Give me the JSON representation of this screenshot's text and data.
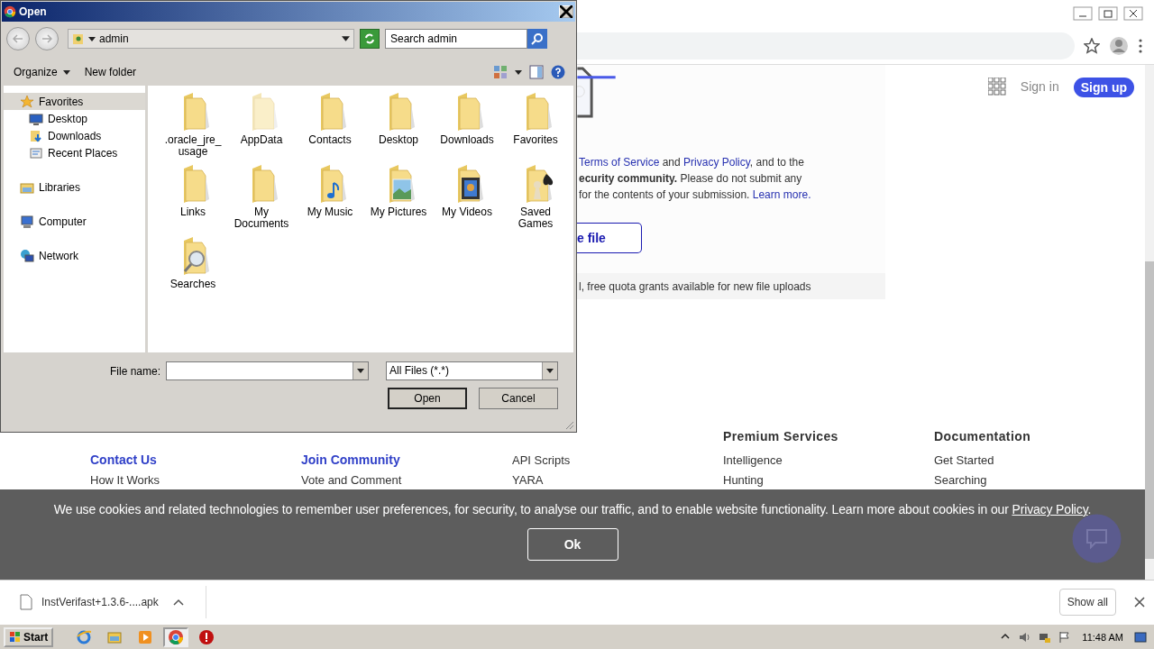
{
  "page": {
    "header": {
      "sign_in": "Sign in",
      "sign_up": "Sign up"
    },
    "upload": {
      "lines": [
        [
          {
            "kind": "link",
            "text": "Terms of Service"
          },
          {
            "kind": "text",
            "text": " and "
          },
          {
            "kind": "link",
            "text": "Privacy Policy"
          },
          {
            "kind": "text",
            "text": ", and to the"
          }
        ],
        [
          {
            "kind": "text",
            "text": "**ecurity community.** Please do not submit any"
          }
        ],
        [
          {
            "kind": "text",
            "text": "for the contents of your submission. "
          },
          {
            "kind": "link",
            "text": "Learn more."
          }
        ]
      ],
      "button": "e file",
      "quota": "l, free quota grants available for new file uploads"
    },
    "footer": {
      "columns": [
        {
          "links": [
            {
              "text": "Contact Us",
              "kind": "primary"
            },
            {
              "text": "How It Works",
              "kind": "plain"
            }
          ]
        },
        {
          "links": [
            {
              "text": "Join Community",
              "kind": "primary"
            },
            {
              "text": "Vote and Comment",
              "kind": "plain"
            }
          ]
        },
        {
          "links": [
            {
              "text": "API Scripts",
              "kind": "plain"
            },
            {
              "text": "YARA",
              "kind": "plain"
            }
          ]
        },
        {
          "heading": "Premium Services",
          "links": [
            {
              "text": "Intelligence",
              "kind": "plain"
            },
            {
              "text": "Hunting",
              "kind": "plain"
            }
          ]
        },
        {
          "heading": "Documentation",
          "links": [
            {
              "text": "Get Started",
              "kind": "plain"
            },
            {
              "text": "Searching",
              "kind": "plain"
            }
          ]
        }
      ]
    },
    "cookie_banner": {
      "text": "We use cookies and related technologies to remember user preferences, for security, to analyse our traffic, and to enable website functionality. Learn more about cookies in our ",
      "link": "Privacy Policy",
      "end": ".",
      "button": "Ok"
    }
  },
  "downloads": {
    "file": "InstVerifast+1.3.6-....apk",
    "show_all": "Show all"
  },
  "taskbar": {
    "start": "Start",
    "apps": [
      {
        "kind": "ie",
        "selected": false
      },
      {
        "kind": "explorer",
        "selected": false
      },
      {
        "kind": "media",
        "selected": false
      },
      {
        "kind": "chrome",
        "selected": true
      },
      {
        "kind": "stop",
        "selected": false
      }
    ],
    "clock": "11:48 AM"
  },
  "dialog": {
    "title": "Open",
    "location": "admin",
    "search": {
      "placeholder": "Search admin"
    },
    "organize": "Organize",
    "new_folder": "New folder",
    "nav": [
      {
        "label": "Favorites",
        "kind": "star",
        "selected": true,
        "children": [
          {
            "label": "Desktop",
            "kind": "desktop",
            "selected": false
          },
          {
            "label": "Downloads",
            "kind": "downloads",
            "selected": false
          },
          {
            "label": "Recent Places",
            "kind": "recent",
            "selected": false
          }
        ]
      },
      {
        "label": "Libraries",
        "kind": "libraries",
        "selected": false
      },
      {
        "label": "Computer",
        "kind": "computer",
        "selected": false
      },
      {
        "label": "Network",
        "kind": "network",
        "selected": false
      }
    ],
    "items": [
      {
        "label": ".oracle_jre_usage",
        "kind": "folder"
      },
      {
        "label": "AppData",
        "kind": "hidden"
      },
      {
        "label": "Contacts",
        "kind": "folder"
      },
      {
        "label": "Desktop",
        "kind": "folder"
      },
      {
        "label": "Downloads",
        "kind": "folder"
      },
      {
        "label": "Favorites",
        "kind": "folder"
      },
      {
        "label": "Links",
        "kind": "folder"
      },
      {
        "label": "My Documents",
        "kind": "folder"
      },
      {
        "label": "My Music",
        "kind": "music"
      },
      {
        "label": "My Pictures",
        "kind": "pictures"
      },
      {
        "label": "My Videos",
        "kind": "videos"
      },
      {
        "label": "Saved Games",
        "kind": "games"
      },
      {
        "label": "Searches",
        "kind": "search"
      }
    ],
    "file_name_label": "File name:",
    "file_type": "All Files (*.*)",
    "buttons": [
      {
        "label": "Open",
        "default": true
      },
      {
        "label": "Cancel",
        "default": false
      }
    ]
  }
}
